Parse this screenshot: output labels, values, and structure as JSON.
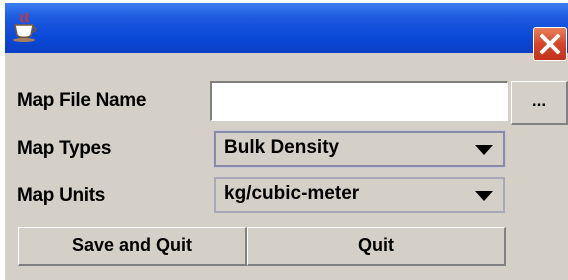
{
  "window": {
    "close_label": "Close"
  },
  "form": {
    "map_file_name_label": "Map File Name",
    "map_file_name_value": "",
    "browse_label": "...",
    "map_types_label": "Map Types",
    "map_types_value": "Bulk Density",
    "map_units_label": "Map Units",
    "map_units_value": "kg/cubic-meter"
  },
  "buttons": {
    "save_and_quit": "Save and Quit",
    "quit": "Quit"
  },
  "icons": {
    "app": "java-coffee-cup-icon",
    "close": "close-icon",
    "dropdown": "chevron-down-icon"
  },
  "colors": {
    "titlebar": "#0a48d8",
    "close": "#d7452a",
    "panel": "#d4d0c8"
  }
}
